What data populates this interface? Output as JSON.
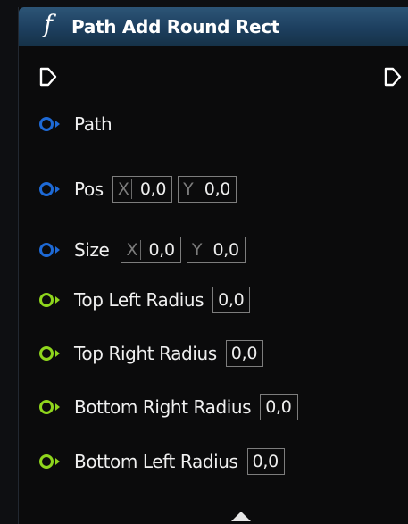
{
  "node": {
    "icon": "function-icon",
    "icon_glyph": "f",
    "title": "Path Add Round Rect",
    "header_color": "#1f4464"
  },
  "exec": {
    "input": "exec-in-pin-icon",
    "output": "exec-out-pin-icon"
  },
  "pins": {
    "path": {
      "label": "Path",
      "type": "object",
      "color": "#1e6ad6"
    },
    "pos": {
      "label": "Pos",
      "type": "vector2d",
      "color": "#1e6ad6",
      "x_axis": "X",
      "x_value": "0,0",
      "y_axis": "Y",
      "y_value": "0,0"
    },
    "size": {
      "label": "Size",
      "type": "vector2d",
      "color": "#1e6ad6",
      "x_axis": "X",
      "x_value": "0,0",
      "y_axis": "Y",
      "y_value": "0,0"
    },
    "top_left_radius": {
      "label": "Top Left Radius",
      "type": "float",
      "color": "#8fd61d",
      "value": "0,0"
    },
    "top_right_radius": {
      "label": "Top Right Radius",
      "type": "float",
      "color": "#8fd61d",
      "value": "0,0"
    },
    "bottom_right_radius": {
      "label": "Bottom Right Radius",
      "type": "float",
      "color": "#8fd61d",
      "value": "0,0"
    },
    "bottom_left_radius": {
      "label": "Bottom Left Radius",
      "type": "float",
      "color": "#8fd61d",
      "value": "0,0"
    }
  },
  "footer": {
    "expand_icon": "expand-arrow-icon"
  }
}
